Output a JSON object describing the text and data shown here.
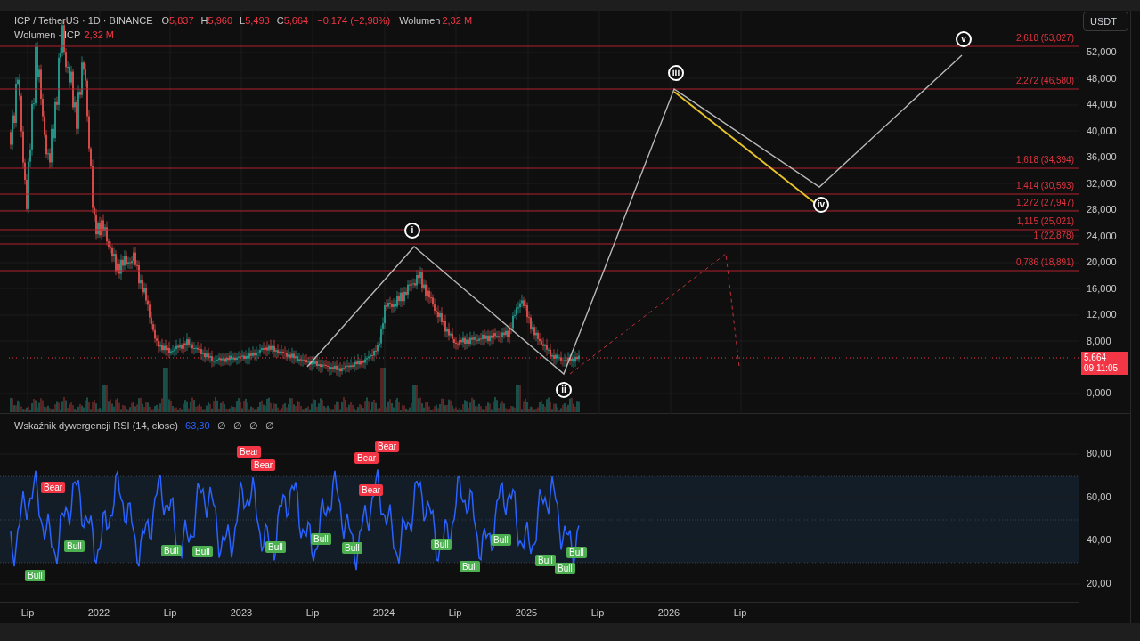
{
  "header": {
    "symbol": "ICP / TetherUS · 1D · BINANCE",
    "ohlc": [
      {
        "label": "O",
        "value": "5,837"
      },
      {
        "label": "H",
        "value": "5,960"
      },
      {
        "label": "L",
        "value": "5,493"
      },
      {
        "label": "C",
        "value": "5,664"
      }
    ],
    "change": "−0,174 (−2,98%)",
    "volume_label": "Wolumen",
    "volume_value": "2,32 M"
  },
  "volume_legend": {
    "label": "Wolumen · ICP",
    "value": "2,32 M"
  },
  "currency_button": "USDT",
  "price_axis": [
    "52,000",
    "48,000",
    "44,000",
    "40,000",
    "36,000",
    "32,000",
    "28,000",
    "24,000",
    "20,000",
    "16,000",
    "12,000",
    "8,000",
    "0,000"
  ],
  "price_tag": {
    "price": "5,664",
    "countdown": "09:11:05"
  },
  "fib_levels": [
    "2,618 (53,027)",
    "2,272 (46,580)",
    "1,618 (34,394)",
    "1,414 (30,593)",
    "1,272 (27,947)",
    "1,115 (25,021)",
    "1 (22,878)",
    "0,786 (18,891)"
  ],
  "wave_labels": [
    "i",
    "ii",
    "iii",
    "iv",
    "v"
  ],
  "rsi": {
    "title": "Wskaźnik dywergencji RSI (14, close)",
    "value": "63,30",
    "extras": [
      "∅",
      "∅",
      "∅",
      "∅"
    ],
    "axis": [
      "80,00",
      "60,00",
      "40,00",
      "20,00"
    ],
    "signals": [
      {
        "kind": "bear",
        "text": "Bear"
      },
      {
        "kind": "bear",
        "text": "Bear"
      },
      {
        "kind": "bear",
        "text": "Bear"
      },
      {
        "kind": "bear",
        "text": "Bear"
      },
      {
        "kind": "bear",
        "text": "Bear"
      },
      {
        "kind": "bear",
        "text": "Bear"
      },
      {
        "kind": "bull",
        "text": "Bull"
      },
      {
        "kind": "bull",
        "text": "Bull"
      },
      {
        "kind": "bull",
        "text": "Bull"
      },
      {
        "kind": "bull",
        "text": "Bull"
      },
      {
        "kind": "bull",
        "text": "Bull"
      },
      {
        "kind": "bull",
        "text": "Bull"
      },
      {
        "kind": "bull",
        "text": "Bull"
      },
      {
        "kind": "bull",
        "text": "Bull"
      },
      {
        "kind": "bull",
        "text": "Bull"
      },
      {
        "kind": "bull",
        "text": "Bull"
      },
      {
        "kind": "bull",
        "text": "Bull"
      },
      {
        "kind": "bull",
        "text": "Bull"
      },
      {
        "kind": "bull",
        "text": "Bull"
      }
    ]
  },
  "time_axis": [
    "Lip",
    "2022",
    "Lip",
    "2023",
    "Lip",
    "2024",
    "Lip",
    "2025",
    "Lip",
    "2026",
    "Lip"
  ]
}
